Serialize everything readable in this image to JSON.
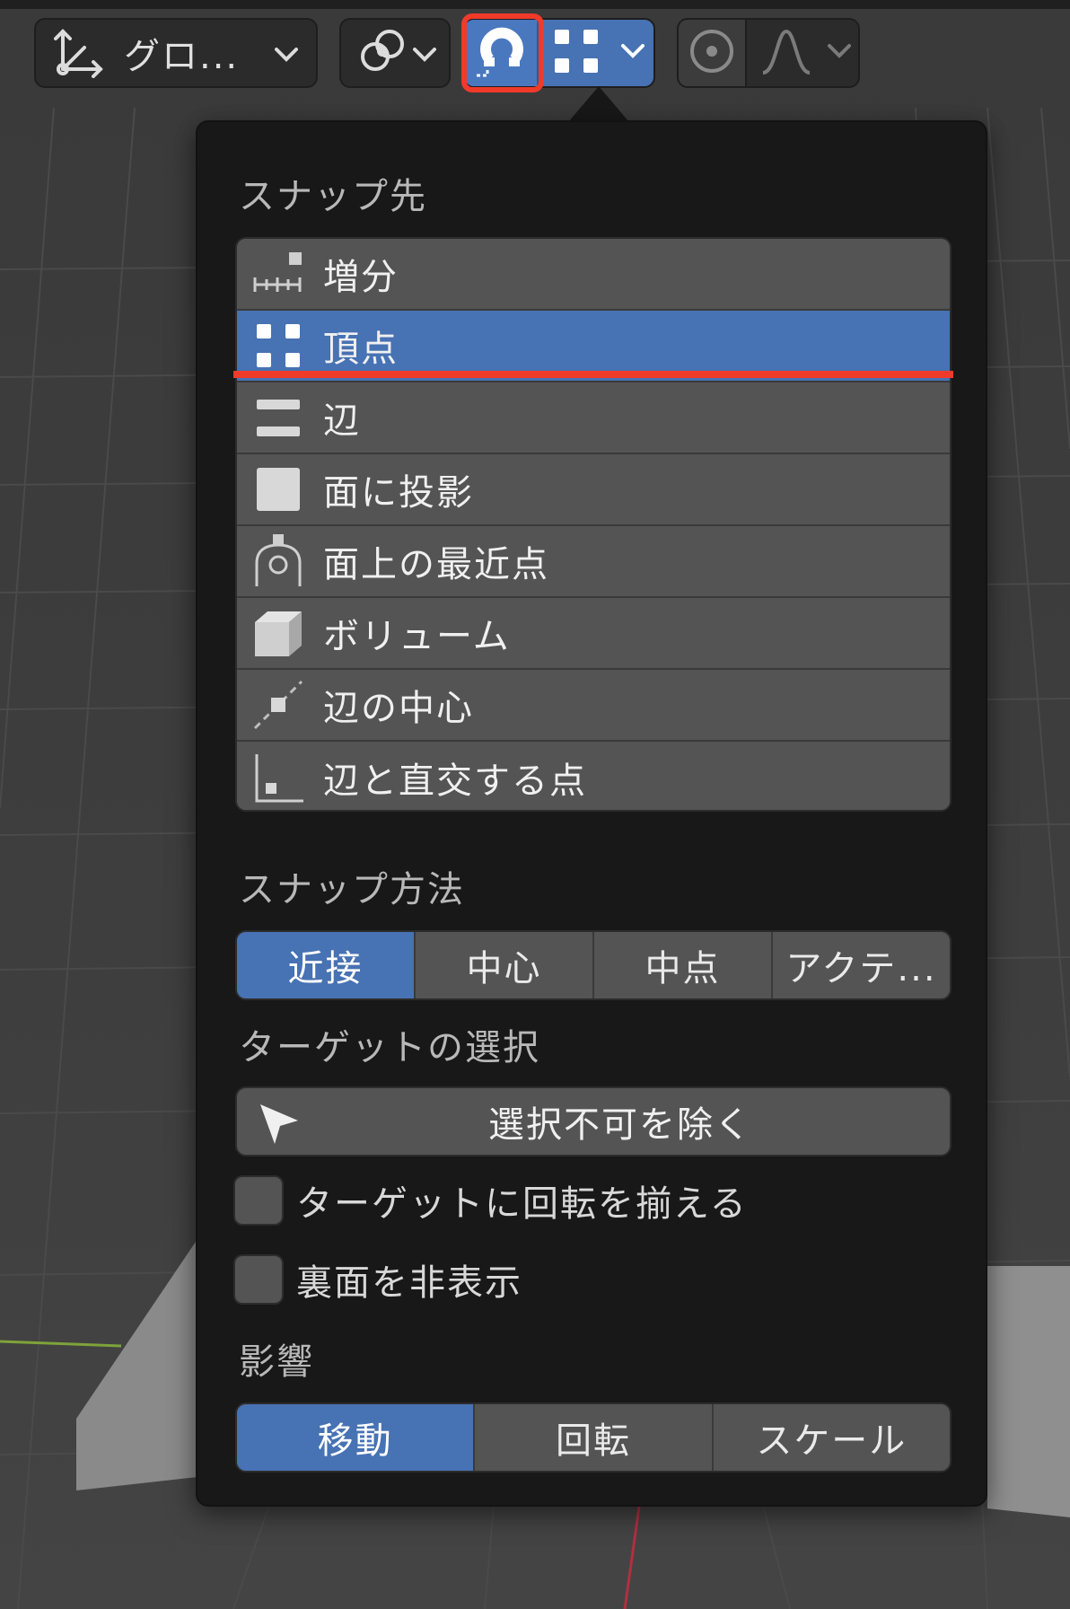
{
  "toolbar": {
    "orientation_label": "グロ...",
    "snap_enabled": true,
    "accent_color": "#4772b3",
    "highlight_color": "#f03a2a"
  },
  "snap_target": {
    "title": "スナップ先",
    "selected": "頂点",
    "items": [
      {
        "label": "増分",
        "icon": "increment-icon"
      },
      {
        "label": "頂点",
        "icon": "vertex-icon"
      },
      {
        "label": "辺",
        "icon": "edge-icon"
      },
      {
        "label": "面に投影",
        "icon": "face-project-icon"
      },
      {
        "label": "面上の最近点",
        "icon": "face-nearest-icon"
      },
      {
        "label": "ボリューム",
        "icon": "volume-icon"
      },
      {
        "label": "辺の中心",
        "icon": "edge-center-icon"
      },
      {
        "label": "辺と直交する点",
        "icon": "edge-perpendicular-icon"
      }
    ]
  },
  "snap_method": {
    "title": "スナップ方法",
    "options": [
      "近接",
      "中心",
      "中点",
      "アクテ..."
    ],
    "active": "近接"
  },
  "target_selection": {
    "title": "ターゲットの選択",
    "button_label": "選択不可を除く",
    "align_rotation_label": "ターゲットに回転を揃える",
    "align_rotation_checked": false,
    "backface_culling_label": "裏面を非表示",
    "backface_culling_checked": false
  },
  "affect": {
    "title": "影響",
    "options": [
      "移動",
      "回転",
      "スケール"
    ],
    "active": "移動"
  }
}
